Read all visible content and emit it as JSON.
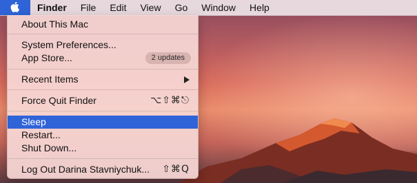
{
  "menubar": {
    "apple_icon": "apple-logo-icon",
    "app_name": "Finder",
    "menus": [
      "File",
      "Edit",
      "View",
      "Go",
      "Window",
      "Help"
    ],
    "highlight_color": "#2f63d8"
  },
  "apple_menu": {
    "about": "About This Mac",
    "system_preferences": "System Preferences...",
    "app_store": "App Store...",
    "app_store_badge": "2 updates",
    "recent_items": "Recent Items",
    "recent_items_icon": "submenu-arrow-icon",
    "force_quit": "Force Quit Finder",
    "force_quit_shortcut": "⌥⇧⌘⎋",
    "sleep": "Sleep",
    "restart": "Restart...",
    "shut_down": "Shut Down...",
    "log_out": "Log Out Darina Stavniychuk...",
    "log_out_shortcut": "⇧⌘Q"
  }
}
